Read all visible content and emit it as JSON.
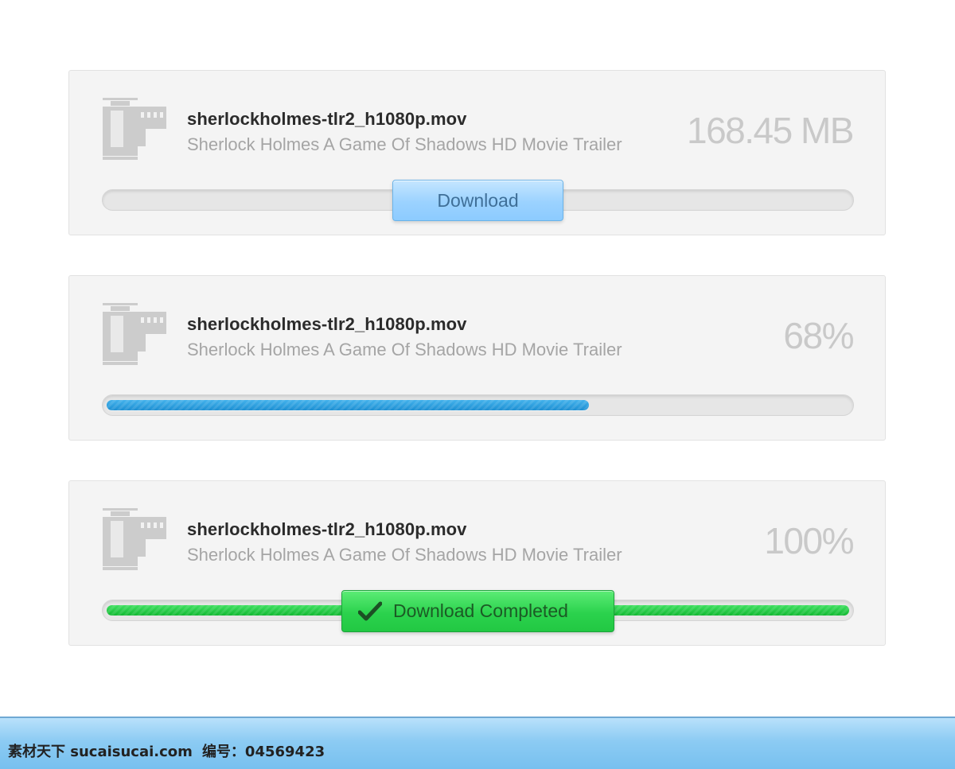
{
  "downloads": [
    {
      "file_name": "sherlockholmes-tlr2_h1080p.mov",
      "description": "Sherlock Holmes A Game Of Shadows HD Movie Trailer",
      "stat": "168.45 MB",
      "state": "ready",
      "progress": 0,
      "button_label": "Download"
    },
    {
      "file_name": "sherlockholmes-tlr2_h1080p.mov",
      "description": "Sherlock Holmes A Game Of Shadows HD Movie Trailer",
      "stat": "68%",
      "state": "downloading",
      "progress": 0.65
    },
    {
      "file_name": "sherlockholmes-tlr2_h1080p.mov",
      "description": "Sherlock Holmes A Game Of Shadows HD Movie Trailer",
      "stat": "100%",
      "state": "completed",
      "progress": 1.0,
      "button_label": "Download Completed"
    }
  ],
  "footer": {
    "site": "素材天下 sucaisucai.com",
    "id_label": "编号：04569423"
  },
  "colors": {
    "progress_blue": "#1d8fd2",
    "progress_green": "#22c843",
    "download_button": "#9bd2ff",
    "complete_button": "#2bd24d"
  },
  "icons": {
    "file": "film-strip-icon",
    "complete": "checkmark-icon"
  }
}
